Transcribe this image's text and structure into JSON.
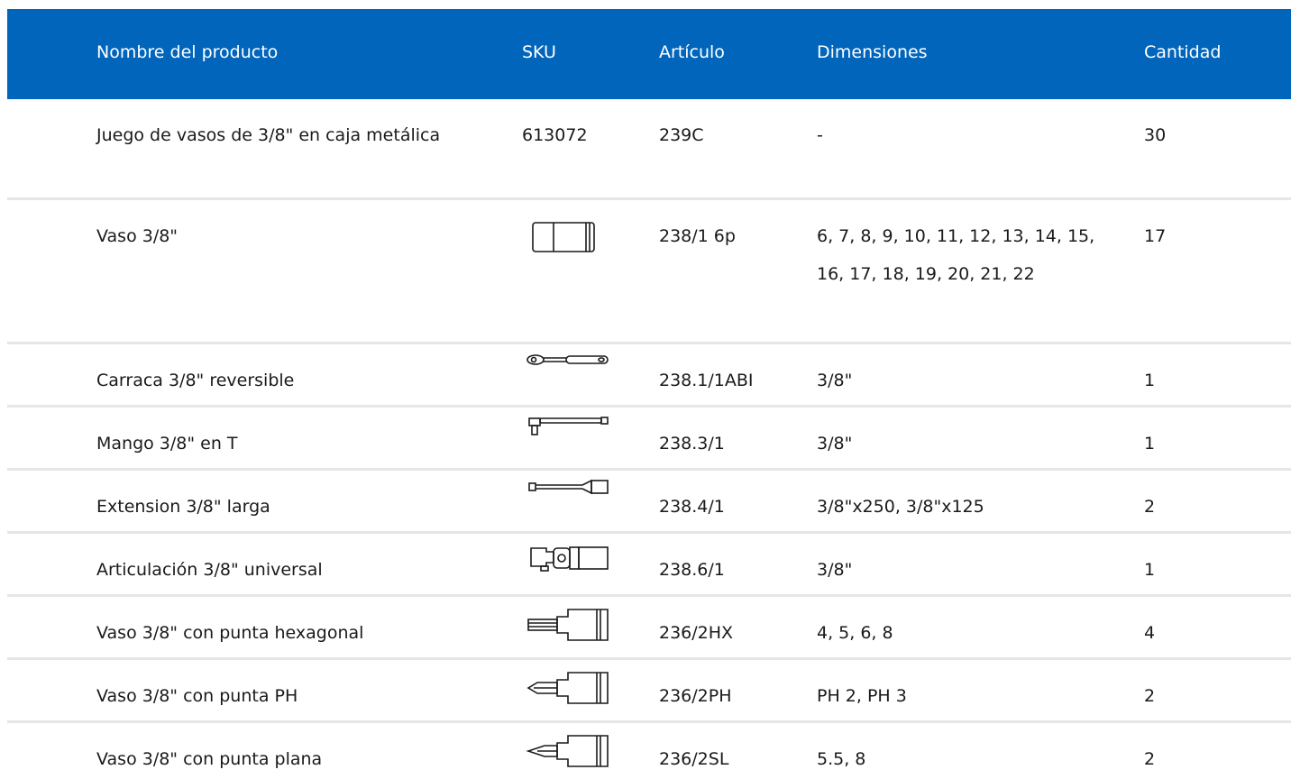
{
  "header": {
    "name": "Nombre del producto",
    "sku": "SKU",
    "article": "Artículo",
    "dimensions": "Dimensiones",
    "quantity": "Cantidad"
  },
  "rows": [
    {
      "name": "Juego de vasos de 3/8\" en caja metálica",
      "sku": "613072",
      "icon": "",
      "article": "239C",
      "dimensions": "-",
      "quantity": "30"
    },
    {
      "name": "Vaso 3/8\"",
      "sku": "",
      "icon": "socket-icon",
      "article": "238/1 6p",
      "dimensions": "6, 7, 8, 9, 10, 11, 12, 13, 14, 15, 16, 17, 18, 19, 20, 21, 22",
      "quantity": "17"
    },
    {
      "name": "Carraca 3/8\" reversible",
      "sku": "",
      "icon": "ratchet-icon",
      "article": "238.1/1ABI",
      "dimensions": "3/8\"",
      "quantity": "1"
    },
    {
      "name": "Mango 3/8\" en T",
      "sku": "",
      "icon": "t-handle-icon",
      "article": "238.3/1",
      "dimensions": "3/8\"",
      "quantity": "1"
    },
    {
      "name": "Extension 3/8\" larga",
      "sku": "",
      "icon": "extension-bar-icon",
      "article": "238.4/1",
      "dimensions": "3/8\"x250, 3/8\"x125",
      "quantity": "2"
    },
    {
      "name": "Articulación 3/8\" universal",
      "sku": "",
      "icon": "universal-joint-icon",
      "article": "238.6/1",
      "dimensions": "3/8\"",
      "quantity": "1"
    },
    {
      "name": "Vaso 3/8\" con punta hexagonal",
      "sku": "",
      "icon": "hex-bit-socket-icon",
      "article": "236/2HX",
      "dimensions": "4, 5, 6, 8",
      "quantity": "4"
    },
    {
      "name": "Vaso 3/8\" con punta PH",
      "sku": "",
      "icon": "phillips-bit-socket-icon",
      "article": "236/2PH",
      "dimensions": "PH 2, PH 3",
      "quantity": "2"
    },
    {
      "name": "Vaso 3/8\" con punta plana",
      "sku": "",
      "icon": "flat-bit-socket-icon",
      "article": "236/2SL",
      "dimensions": "5.5, 8",
      "quantity": "2"
    }
  ],
  "colors": {
    "header_bg": "#0165BC",
    "header_text": "#ffffff",
    "row_divider": "#e6e6e6"
  }
}
